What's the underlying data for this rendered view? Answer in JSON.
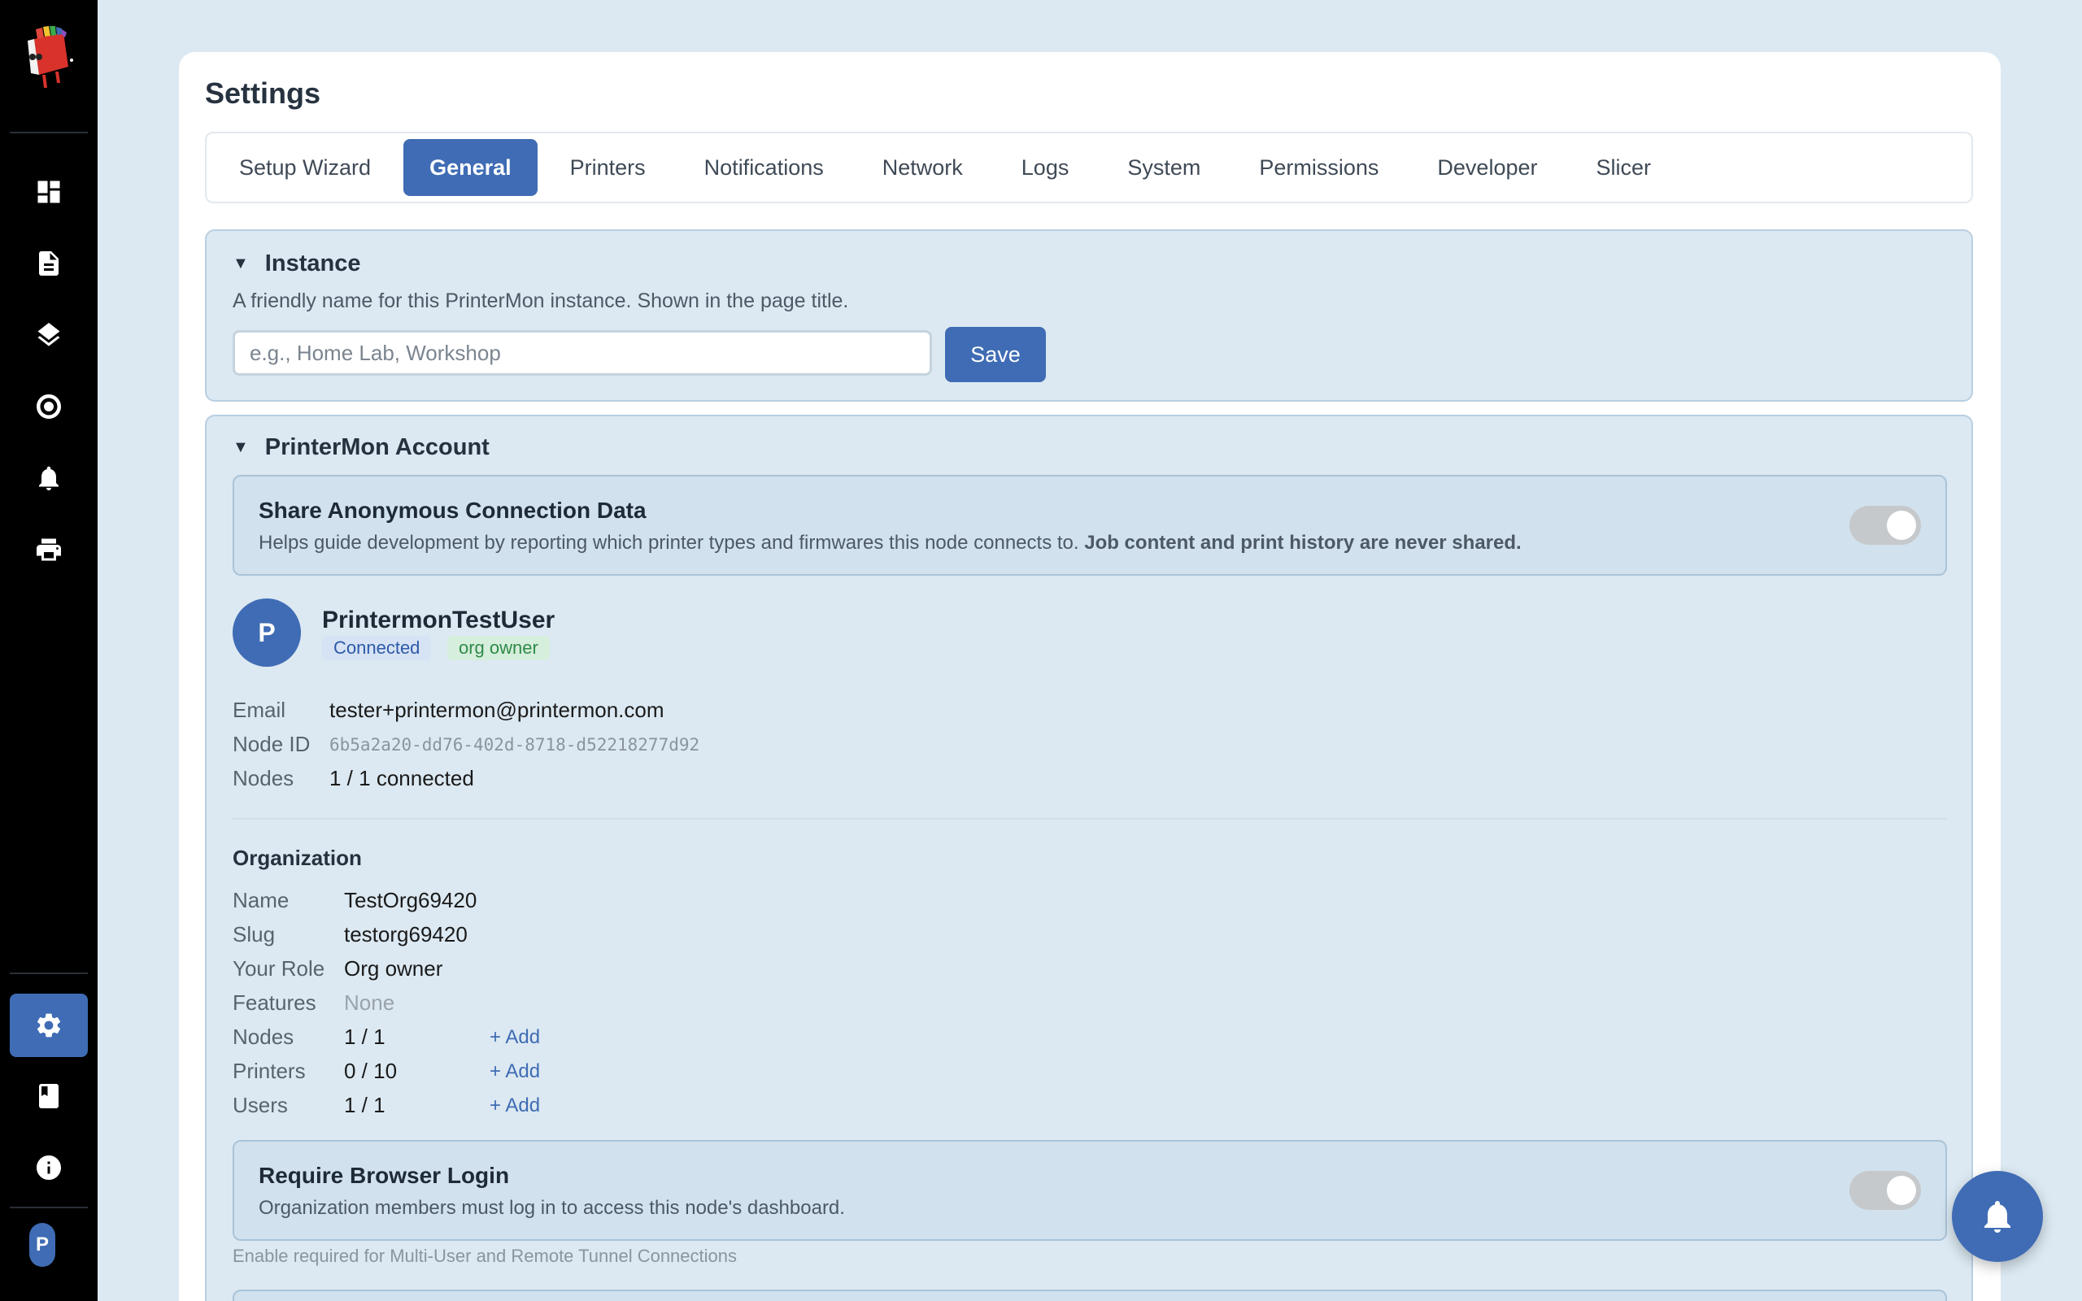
{
  "page": {
    "title": "Settings"
  },
  "tabs": [
    {
      "label": "Setup Wizard"
    },
    {
      "label": "General",
      "active": true
    },
    {
      "label": "Printers"
    },
    {
      "label": "Notifications"
    },
    {
      "label": "Network"
    },
    {
      "label": "Logs"
    },
    {
      "label": "System"
    },
    {
      "label": "Permissions"
    },
    {
      "label": "Developer"
    },
    {
      "label": "Slicer"
    }
  ],
  "sidebar": {
    "items": [
      {
        "icon": "dashboard-icon"
      },
      {
        "icon": "document-icon"
      },
      {
        "icon": "layers-icon"
      },
      {
        "icon": "target-icon"
      },
      {
        "icon": "bell-icon"
      },
      {
        "icon": "printer-icon"
      },
      {
        "icon": "gear-icon",
        "active": true
      },
      {
        "icon": "book-icon"
      },
      {
        "icon": "info-icon"
      }
    ],
    "avatar_initial": "P"
  },
  "instance": {
    "heading": "Instance",
    "description": "A friendly name for this PrinterMon instance. Shown in the page title.",
    "name_placeholder": "e.g., Home Lab, Workshop",
    "save_label": "Save"
  },
  "account": {
    "heading": "PrinterMon Account",
    "share": {
      "title": "Share Anonymous Connection Data",
      "description": "Helps guide development by reporting which printer types and firmwares this node connects to.",
      "description_bold": "Job content and print history are never shared.",
      "enabled": false
    },
    "user": {
      "avatar_initial": "P",
      "name": "PrintermonTestUser",
      "status_badge": "Connected",
      "role_badge": "org owner"
    },
    "fields": {
      "email_label": "Email",
      "email_value": "tester+printermon@printermon.com",
      "node_id_label": "Node ID",
      "node_id_value": "6b5a2a20-dd76-402d-8718-d52218277d92",
      "nodes_label": "Nodes",
      "nodes_value": "1 / 1 connected"
    },
    "organization": {
      "heading": "Organization",
      "name_label": "Name",
      "name_value": "TestOrg69420",
      "slug_label": "Slug",
      "slug_value": "testorg69420",
      "role_label": "Your Role",
      "role_value": "Org owner",
      "features_label": "Features",
      "features_value": "None",
      "nodes_label": "Nodes",
      "nodes_value": "1 / 1",
      "printers_label": "Printers",
      "printers_value": "0 / 10",
      "users_label": "Users",
      "users_value": "1 / 1",
      "add_label": "+ Add"
    },
    "login": {
      "title": "Require Browser Login",
      "description": "Organization members must log in to access this node's dashboard.",
      "enabled": false,
      "hint": "Enable required for Multi-User and Remote Tunnel Connections"
    }
  },
  "fab": {
    "icon": "bell-icon"
  }
}
